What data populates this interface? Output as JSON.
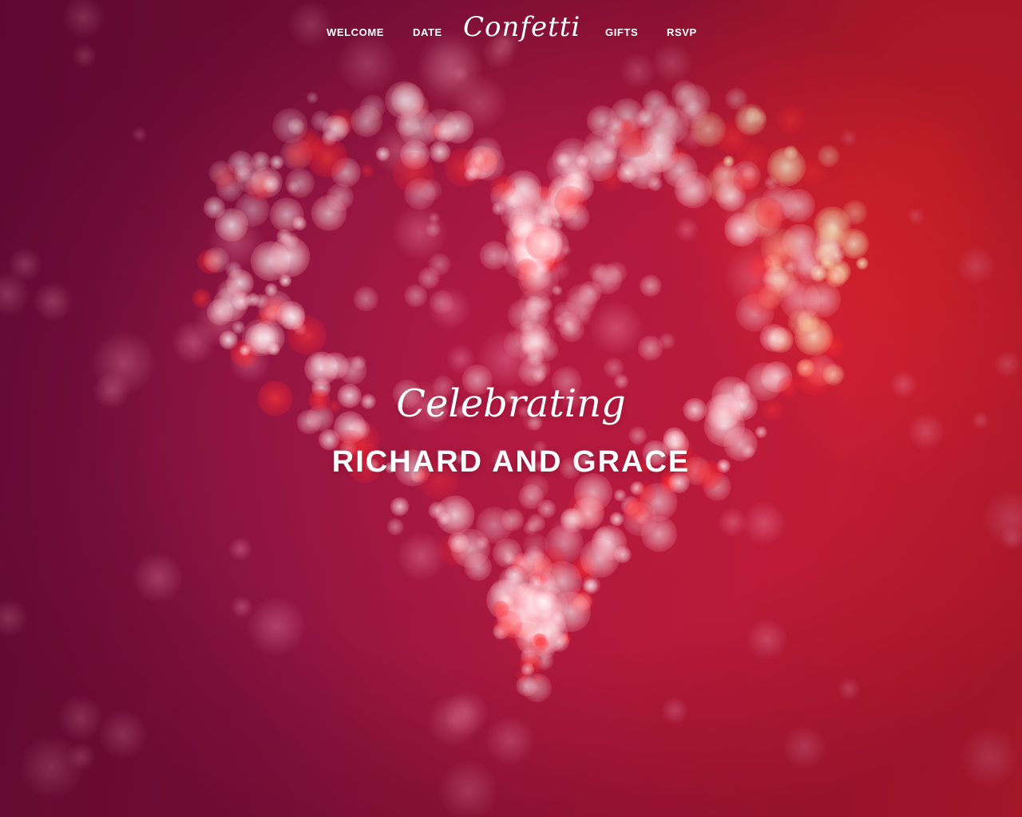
{
  "nav": {
    "welcome": "WELCOME",
    "date": "DATE",
    "brand": "Confetti",
    "gifts": "GIFTS",
    "rsvp": "RSVP"
  },
  "hero": {
    "script_line": "Celebrating",
    "names": "RICHARD AND GRACE",
    "background": "heart-bokeh-image"
  },
  "colors": {
    "deep": "#6b0c3b",
    "mid": "#b11838",
    "bright": "#d6202e",
    "text": "#ffffff"
  }
}
